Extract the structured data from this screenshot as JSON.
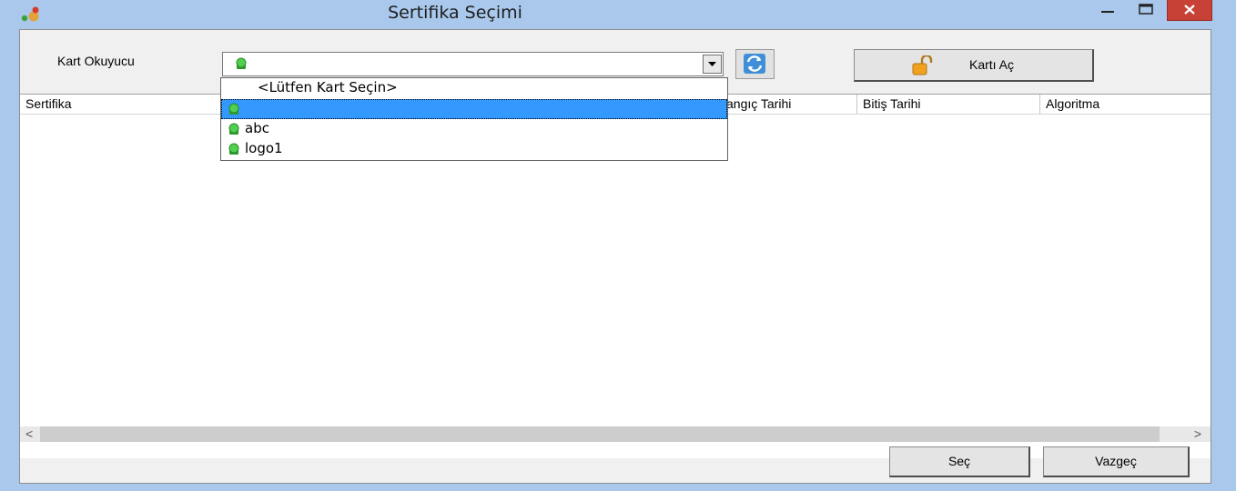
{
  "window": {
    "title": "Sertifika Seçimi"
  },
  "reader": {
    "label": "Kart Okuyucu"
  },
  "open_card_button": {
    "label": "Kartı Aç"
  },
  "columns": [
    "Sertifika",
    "angıç Tarihi",
    "Bitiş Tarihi",
    "Algoritma"
  ],
  "dropdown": {
    "placeholder": "<Lütfen Kart Seçin>",
    "items": [
      "",
      "abc",
      "logo1"
    ]
  },
  "buttons": {
    "select": "Seç",
    "cancel": "Vazgeç"
  },
  "scrollbar": {
    "left_arrow": "<",
    "right_arrow": ">"
  },
  "colors": {
    "selection": "#3399ff",
    "led": "#3fbf3f",
    "close": "#c74136"
  }
}
